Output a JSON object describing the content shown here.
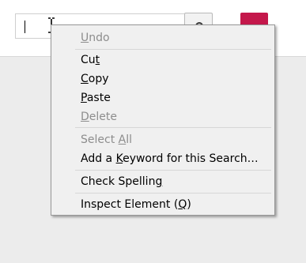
{
  "search": {
    "value": "",
    "placeholder": ""
  },
  "icons": {
    "search_button": "magnifier-icon",
    "cursor": "text-cursor-icon"
  },
  "colors": {
    "accent_button": "#c4184b",
    "menu_background": "#f0f0f0",
    "disabled_text": "#8d8d8d"
  },
  "context_menu": {
    "undo": {
      "pre": "",
      "key": "U",
      "post": "ndo",
      "enabled": false
    },
    "cut": {
      "pre": "Cu",
      "key": "t",
      "post": "",
      "enabled": true
    },
    "copy": {
      "pre": "",
      "key": "C",
      "post": "opy",
      "enabled": true
    },
    "paste": {
      "pre": "",
      "key": "P",
      "post": "aste",
      "enabled": true
    },
    "delete": {
      "pre": "",
      "key": "D",
      "post": "elete",
      "enabled": false
    },
    "select_all": {
      "pre": "Select ",
      "key": "A",
      "post": "ll",
      "enabled": false
    },
    "add_keyword": {
      "pre": "Add a ",
      "key": "K",
      "post": "eyword for this Search…",
      "enabled": true
    },
    "check_spelling": {
      "pre": "Check Spellin",
      "key": "g",
      "post": "",
      "enabled": true
    },
    "inspect": {
      "pre": "Inspect Element (",
      "key": "Q",
      "post": ")",
      "enabled": true
    }
  }
}
